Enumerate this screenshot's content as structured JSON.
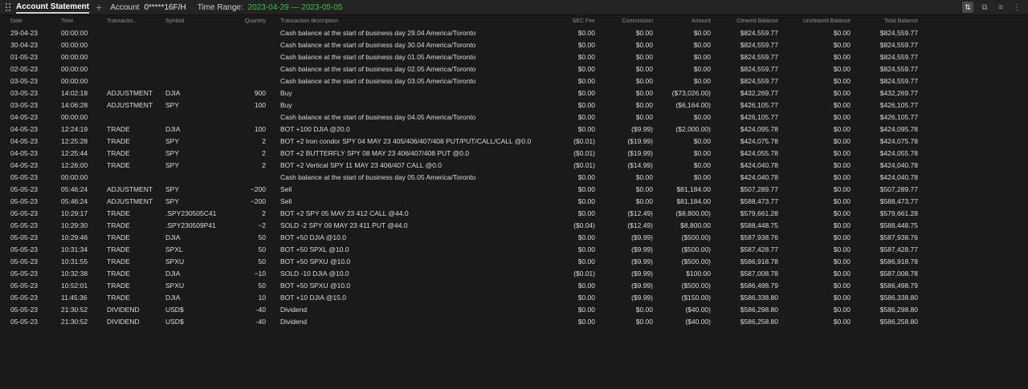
{
  "header": {
    "title": "Account Statement",
    "add_tab": "+",
    "account_label": "Account",
    "account_value": "0*****16F/H",
    "time_range_label": "Time Range:",
    "time_range_value": "2023-04-29 — 2023-05-05",
    "range_color": "#3fbf3f"
  },
  "toolbar_icons": [
    "sync-icon",
    "popout-icon",
    "menu-icon",
    "more-icon"
  ],
  "columns": {
    "date": "Date",
    "time": "Time",
    "type": "Transactio...",
    "symbol": "Symbol",
    "quantity": "Quantity",
    "description": "Transaction description",
    "sec_fee": "SEC Fee",
    "commission": "Commission",
    "amount": "Amount",
    "cleared": "Cleared Balance",
    "uncleared": "Uncleared Balance",
    "total": "Total Balance"
  },
  "rows": [
    {
      "date": "29-04-23",
      "time": "00:00:00",
      "type": "",
      "symbol": "",
      "qty": "",
      "desc": "Cash balance at the start of business day 29.04 America/Toronto",
      "sec": "$0.00",
      "comm": "$0.00",
      "amt": "$0.00",
      "clr": "$824,559.77",
      "unc": "$0.00",
      "tot": "$824,559.77"
    },
    {
      "date": "30-04-23",
      "time": "00:00:00",
      "type": "",
      "symbol": "",
      "qty": "",
      "desc": "Cash balance at the start of business day 30.04 America/Toronto",
      "sec": "$0.00",
      "comm": "$0.00",
      "amt": "$0.00",
      "clr": "$824,559.77",
      "unc": "$0.00",
      "tot": "$824,559.77"
    },
    {
      "date": "01-05-23",
      "time": "00:00:00",
      "type": "",
      "symbol": "",
      "qty": "",
      "desc": "Cash balance at the start of business day 01.05 America/Toronto",
      "sec": "$0.00",
      "comm": "$0.00",
      "amt": "$0.00",
      "clr": "$824,559.77",
      "unc": "$0.00",
      "tot": "$824,559.77"
    },
    {
      "date": "02-05-23",
      "time": "00:00:00",
      "type": "",
      "symbol": "",
      "qty": "",
      "desc": "Cash balance at the start of business day 02.05 America/Toronto",
      "sec": "$0.00",
      "comm": "$0.00",
      "amt": "$0.00",
      "clr": "$824,559.77",
      "unc": "$0.00",
      "tot": "$824,559.77"
    },
    {
      "date": "03-05-23",
      "time": "00:00:00",
      "type": "",
      "symbol": "",
      "qty": "",
      "desc": "Cash balance at the start of business day 03.05 America/Toronto",
      "sec": "$0.00",
      "comm": "$0.00",
      "amt": "$0.00",
      "clr": "$824,559.77",
      "unc": "$0.00",
      "tot": "$824,559.77"
    },
    {
      "date": "03-05-23",
      "time": "14:02:18",
      "type": "ADJUSTMENT",
      "symbol": "DJIA",
      "qty": "900",
      "desc": "Buy",
      "sec": "$0.00",
      "comm": "$0.00",
      "amt": "($73,026.00)",
      "clr": "$432,269.77",
      "unc": "$0.00",
      "tot": "$432,269.77"
    },
    {
      "date": "03-05-23",
      "time": "14:06:28",
      "type": "ADJUSTMENT",
      "symbol": "SPY",
      "qty": "100",
      "desc": "Buy",
      "sec": "$0.00",
      "comm": "$0.00",
      "amt": "($6,164.00)",
      "clr": "$426,105.77",
      "unc": "$0.00",
      "tot": "$426,105.77"
    },
    {
      "date": "04-05-23",
      "time": "00:00:00",
      "type": "",
      "symbol": "",
      "qty": "",
      "desc": "Cash balance at the start of business day 04.05 America/Toronto",
      "sec": "$0.00",
      "comm": "$0.00",
      "amt": "$0.00",
      "clr": "$426,105.77",
      "unc": "$0.00",
      "tot": "$426,105.77"
    },
    {
      "date": "04-05-23",
      "time": "12:24:19",
      "type": "TRADE",
      "symbol": "DJIA",
      "qty": "100",
      "desc": "BOT +100 DJIA @20.0",
      "sec": "$0.00",
      "comm": "($9.99)",
      "amt": "($2,000.00)",
      "clr": "$424,095.78",
      "unc": "$0.00",
      "tot": "$424,095.78"
    },
    {
      "date": "04-05-23",
      "time": "12:25:28",
      "type": "TRADE",
      "symbol": "SPY",
      "qty": "2",
      "desc": "BOT +2 Iron condor SPY 04 MAY 23 405/406/407/408 PUT/PUT/CALL/CALL @0.0",
      "sec": "($0.01)",
      "comm": "($19.99)",
      "amt": "$0.00",
      "clr": "$424,075.78",
      "unc": "$0.00",
      "tot": "$424,075.78"
    },
    {
      "date": "04-05-23",
      "time": "12:25:44",
      "type": "TRADE",
      "symbol": "SPY",
      "qty": "2",
      "desc": "BOT +2 BUTTERFLY SPY 08 MAY 23 406/407/408 PUT @0.0",
      "sec": "($0.01)",
      "comm": "($19.99)",
      "amt": "$0.00",
      "clr": "$424,055.78",
      "unc": "$0.00",
      "tot": "$424,055.78"
    },
    {
      "date": "04-05-23",
      "time": "12:26:00",
      "type": "TRADE",
      "symbol": "SPY",
      "qty": "2",
      "desc": "BOT +2 Vertical SPY 11 MAY 23 406/407 CALL @0.0",
      "sec": "($0.01)",
      "comm": "($14.99)",
      "amt": "$0.00",
      "clr": "$424,040.78",
      "unc": "$0.00",
      "tot": "$424,040.78"
    },
    {
      "date": "05-05-23",
      "time": "00:00:00",
      "type": "",
      "symbol": "",
      "qty": "",
      "desc": "Cash balance at the start of business day 05.05 America/Toronto",
      "sec": "$0.00",
      "comm": "$0.00",
      "amt": "$0.00",
      "clr": "$424,040.78",
      "unc": "$0.00",
      "tot": "$424,040.78"
    },
    {
      "date": "05-05-23",
      "time": "05:46:24",
      "type": "ADJUSTMENT",
      "symbol": "SPY",
      "qty": "−200",
      "desc": "Sell",
      "sec": "$0.00",
      "comm": "$0.00",
      "amt": "$81,184.00",
      "clr": "$507,289.77",
      "unc": "$0.00",
      "tot": "$507,289.77"
    },
    {
      "date": "05-05-23",
      "time": "05:46:24",
      "type": "ADJUSTMENT",
      "symbol": "SPY",
      "qty": "−200",
      "desc": "Sell",
      "sec": "$0.00",
      "comm": "$0.00",
      "amt": "$81,184.00",
      "clr": "$588,473.77",
      "unc": "$0.00",
      "tot": "$588,473.77"
    },
    {
      "date": "05-05-23",
      "time": "10:29:17",
      "type": "TRADE",
      "symbol": ".SPY230505C41",
      "qty": "2",
      "desc": "BOT +2 SPY 05 MAY 23 412 CALL @44.0",
      "sec": "$0.00",
      "comm": "($12.49)",
      "amt": "($8,800.00)",
      "clr": "$579,661.28",
      "unc": "$0.00",
      "tot": "$579,661.28"
    },
    {
      "date": "05-05-23",
      "time": "10:29:30",
      "type": "TRADE",
      "symbol": ".SPY230509P41",
      "qty": "−2",
      "desc": "SOLD -2 SPY 09 MAY 23 411 PUT @44.0",
      "sec": "($0.04)",
      "comm": "($12.49)",
      "amt": "$8,800.00",
      "clr": "$588,448.75",
      "unc": "$0.00",
      "tot": "$588,448.75"
    },
    {
      "date": "05-05-23",
      "time": "10:29:46",
      "type": "TRADE",
      "symbol": "DJIA",
      "qty": "50",
      "desc": "BOT +50 DJIA @10.0",
      "sec": "$0.00",
      "comm": "($9.99)",
      "amt": "($500.00)",
      "clr": "$587,938.76",
      "unc": "$0.00",
      "tot": "$587,938.76"
    },
    {
      "date": "05-05-23",
      "time": "10:31:34",
      "type": "TRADE",
      "symbol": "SPXL",
      "qty": "50",
      "desc": "BOT +50 SPXL @10.0",
      "sec": "$0.00",
      "comm": "($9.99)",
      "amt": "($500.00)",
      "clr": "$587,428.77",
      "unc": "$0.00",
      "tot": "$587,428.77"
    },
    {
      "date": "05-05-23",
      "time": "10:31:55",
      "type": "TRADE",
      "symbol": "SPXU",
      "qty": "50",
      "desc": "BOT +50 SPXU @10.0",
      "sec": "$0.00",
      "comm": "($9.99)",
      "amt": "($500.00)",
      "clr": "$586,918.78",
      "unc": "$0.00",
      "tot": "$586,918.78"
    },
    {
      "date": "05-05-23",
      "time": "10:32:38",
      "type": "TRADE",
      "symbol": "DJIA",
      "qty": "−10",
      "desc": "SOLD -10 DJIA @10.0",
      "sec": "($0.01)",
      "comm": "($9.99)",
      "amt": "$100.00",
      "clr": "$587,008.78",
      "unc": "$0.00",
      "tot": "$587,008.78"
    },
    {
      "date": "05-05-23",
      "time": "10:52:01",
      "type": "TRADE",
      "symbol": "SPXU",
      "qty": "50",
      "desc": "BOT +50 SPXU @10.0",
      "sec": "$0.00",
      "comm": "($9.99)",
      "amt": "($500.00)",
      "clr": "$586,498.79",
      "unc": "$0.00",
      "tot": "$586,498.79"
    },
    {
      "date": "05-05-23",
      "time": "11:45:36",
      "type": "TRADE",
      "symbol": "DJIA",
      "qty": "10",
      "desc": "BOT +10 DJIA @15.0",
      "sec": "$0.00",
      "comm": "($9.99)",
      "amt": "($150.00)",
      "clr": "$586,338.80",
      "unc": "$0.00",
      "tot": "$586,338.80"
    },
    {
      "date": "05-05-23",
      "time": "21:30:52",
      "type": "DIVIDEND",
      "symbol": "USD$",
      "qty": "-40",
      "desc": "Dividend",
      "sec": "$0.00",
      "comm": "$0.00",
      "amt": "($40.00)",
      "clr": "$586,298.80",
      "unc": "$0.00",
      "tot": "$586,298.80"
    },
    {
      "date": "05-05-23",
      "time": "21:30:52",
      "type": "DIVIDEND",
      "symbol": "USD$",
      "qty": "-40",
      "desc": "Dividend",
      "sec": "$0.00",
      "comm": "$0.00",
      "amt": "($40.00)",
      "clr": "$586,258.80",
      "unc": "$0.00",
      "tot": "$586,258.80"
    }
  ]
}
